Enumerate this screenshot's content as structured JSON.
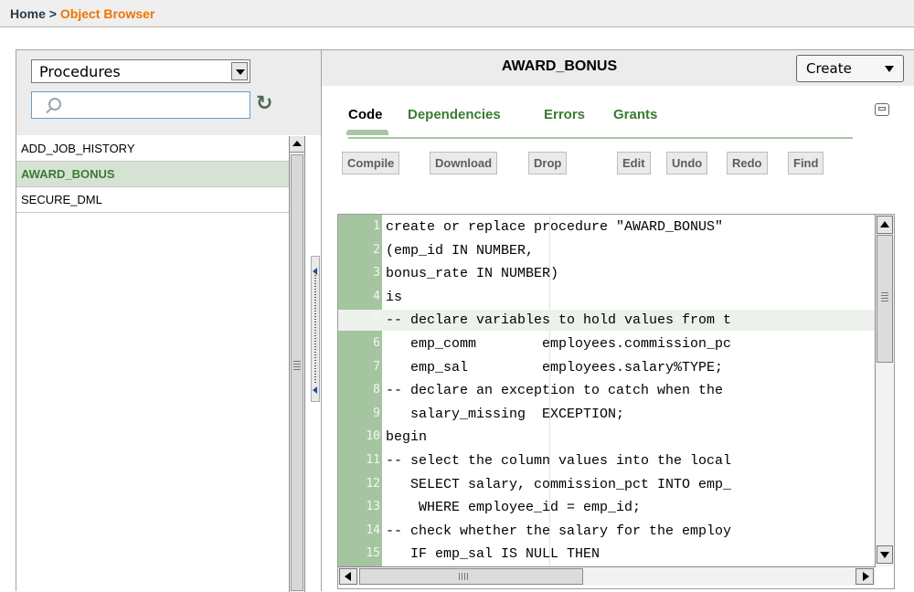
{
  "breadcrumb": {
    "home": "Home",
    "separator": " > ",
    "current": "Object Browser"
  },
  "object_type_select": {
    "value": "Procedures"
  },
  "search": {
    "value": ""
  },
  "object_list": [
    "ADD_JOB_HISTORY",
    "AWARD_BONUS",
    "SECURE_DML"
  ],
  "selected_object": "AWARD_BONUS",
  "object_header": {
    "title": "AWARD_BONUS",
    "create_label": "Create"
  },
  "tabs": [
    "Code",
    "Dependencies",
    "Errors",
    "Grants"
  ],
  "active_tab": "Code",
  "toolbar": {
    "compile": "Compile",
    "download": "Download",
    "drop": "Drop",
    "edit": "Edit",
    "undo": "Undo",
    "redo": "Redo",
    "find": "Find"
  },
  "code_lines": [
    "create or replace procedure \"AWARD_BONUS\" ",
    "(emp_id IN NUMBER,",
    "bonus_rate IN NUMBER)",
    "is",
    "-- declare variables to hold values from t",
    "   emp_comm        employees.commission_pc",
    "   emp_sal         employees.salary%TYPE;",
    "-- declare an exception to catch when the ",
    "   salary_missing  EXCEPTION;",
    "begin",
    "-- select the column values into the local",
    "   SELECT salary, commission_pct INTO emp_",
    "    WHERE employee_id = emp_id;",
    "-- check whether the salary for the employ",
    "   IF emp_sal IS NULL THEN"
  ],
  "highlighted_line": 5,
  "colors": {
    "accent_green": "#3a7b32",
    "breadcrumb_current": "#f07300",
    "gutter": "#a5c5a0"
  }
}
